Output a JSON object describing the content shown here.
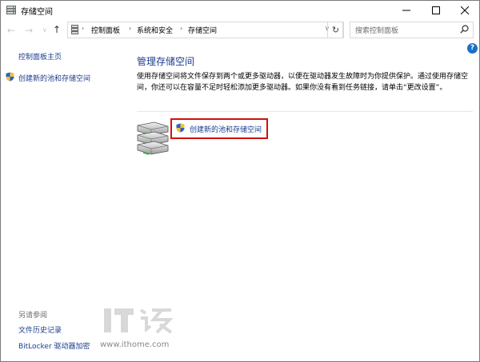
{
  "window": {
    "title": "存储空间"
  },
  "address": {
    "crumbs": [
      "控制面板",
      "系统和安全",
      "存储空间"
    ]
  },
  "search": {
    "placeholder": "搜索控制面板"
  },
  "help": {
    "label": "?"
  },
  "left": {
    "home": "控制面板主页",
    "create": "创建新的池和存储空间",
    "see_also": "另请参阅",
    "links": [
      "文件历史记录",
      "BitLocker 驱动器加密"
    ]
  },
  "main": {
    "heading": "管理存储空间",
    "description": "使用存储空间将文件保存到两个或更多驱动器，以便在驱动器发生故障时为你提供保护。通过使用存储空间，你还可以在容量不足时轻松添加更多驱动器。如果你没有看到任务链接，请单击“更改设置”。",
    "create_link": "创建新的池和存储空间"
  },
  "watermark": {
    "url": "www.ithome.com"
  },
  "colors": {
    "link": "#1a3e8e",
    "heading": "#1c3c8f",
    "highlight": "#d01010",
    "help": "#1b6fc8"
  }
}
